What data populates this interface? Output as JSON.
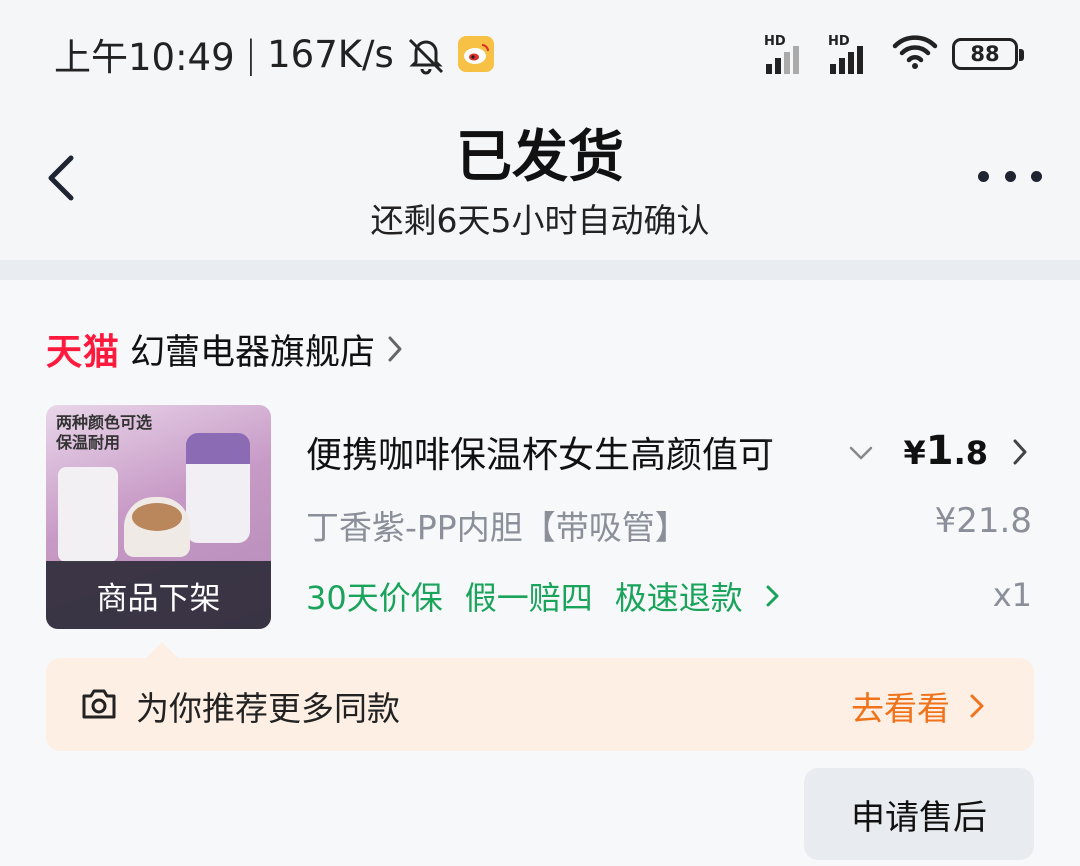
{
  "status_bar": {
    "time": "上午10:49",
    "separator": "|",
    "net_speed": "167K/s",
    "signal1_label": "HD",
    "signal2_label": "HD",
    "battery": "88"
  },
  "header": {
    "title": "已发货",
    "subtitle": "还剩6天5小时自动确认"
  },
  "shop": {
    "badge": "天猫",
    "name": "幻蕾电器旗舰店"
  },
  "product": {
    "image_text_line1": "两种颜色可选",
    "image_text_line2": "保温耐用",
    "status_overlay": "商品下架",
    "title": "便携咖啡保温杯女生高颜值可",
    "price_symbol": "¥",
    "price_int": "1",
    "price_dec": ".8",
    "sku": "丁香紫-PP内胆【带吸管】",
    "original_price": "¥21.8",
    "services": [
      "30天价保",
      "假一赔四",
      "极速退款"
    ],
    "quantity": "x1"
  },
  "recommend": {
    "text": "为你推荐更多同款",
    "link": "去看看"
  },
  "actions": {
    "after_sale": "申请售后"
  },
  "colors": {
    "tmall_red": "#ff1a3d",
    "service_green": "#1aa35a",
    "link_orange": "#f0721b",
    "recommend_bg": "#fdefe4"
  }
}
